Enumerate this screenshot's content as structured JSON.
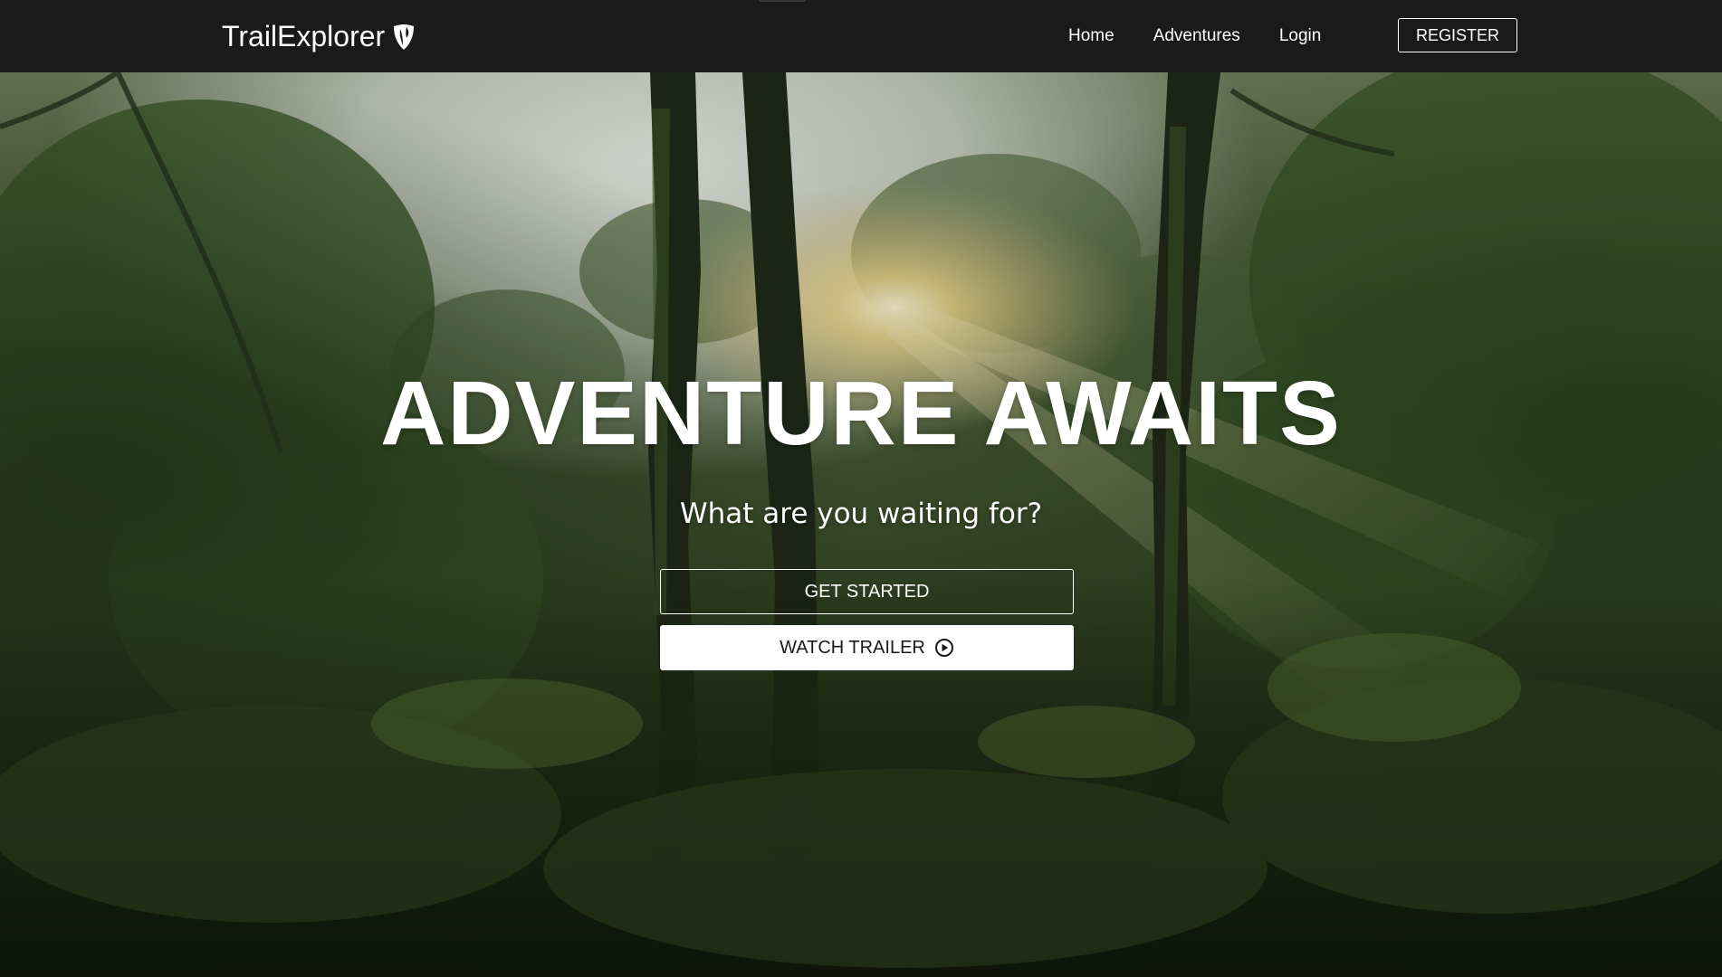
{
  "brand": {
    "name": "TrailExplorer",
    "logo_icon": "shield-leaf-icon"
  },
  "nav": {
    "items": [
      {
        "label": "Home"
      },
      {
        "label": "Adventures"
      },
      {
        "label": "Login"
      }
    ],
    "register_label": "REGISTER"
  },
  "hero": {
    "background": "forest-sunlight-image",
    "title": "ADVENTURE AWAITS",
    "subtitle": "What are you waiting for?",
    "primary_button_label": "GET STARTED",
    "secondary_button_label": "WATCH TRAILER",
    "secondary_button_icon": "play-circle-icon"
  },
  "colors": {
    "navbar_bg": "#1b1a1b",
    "text": "#ffffff",
    "button_light_bg": "#ffffff",
    "button_light_text": "#1a1a1a"
  }
}
